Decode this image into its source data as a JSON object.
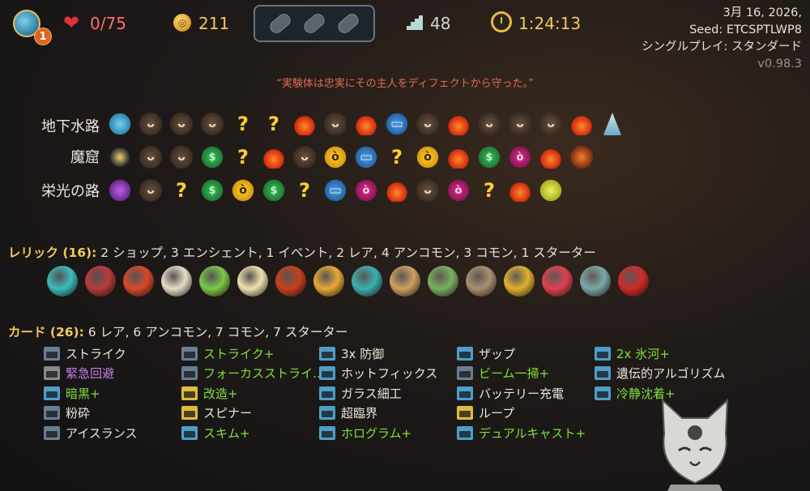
{
  "topbar": {
    "ascension": "1",
    "hp": "0/75",
    "gold": "211",
    "floor": "48",
    "time": "1:24:13",
    "potions": [
      "empty-slot",
      "empty-slot",
      "empty-slot"
    ]
  },
  "run_info": {
    "date": "3月 16, 2026,",
    "seed": "Seed: ETCSPTLWP8",
    "mode": "シングルプレイ: スタンダード",
    "version": "v0.98.3"
  },
  "quote": "“実験体は忠実にその主人をディフェクトから守った。”",
  "map": {
    "acts": [
      {
        "name": "地下水路",
        "nodes": [
          "boss-blue",
          "monster",
          "monster",
          "monster",
          "unknown",
          "unknown",
          "rest",
          "monster",
          "rest",
          "treasure",
          "monster",
          "rest",
          "monster",
          "monster",
          "monster",
          "rest",
          "final-crystal"
        ]
      },
      {
        "name": "魔窟",
        "nodes": [
          "boss-dark",
          "monster",
          "monster",
          "shop",
          "unknown",
          "rest",
          "monster",
          "elite",
          "treasure",
          "unknown",
          "elite",
          "rest",
          "shop",
          "elite2",
          "rest",
          "final-orange"
        ]
      },
      {
        "name": "栄光の路",
        "nodes": [
          "boss-purple",
          "monster",
          "unknown",
          "shop",
          "elite",
          "shop",
          "unknown",
          "treasure",
          "elite2",
          "rest",
          "monster",
          "elite2",
          "unknown",
          "rest",
          "final-yellow"
        ]
      }
    ],
    "node_glyphs": {
      "monster": "ᴗ",
      "unknown": "?",
      "rest": "",
      "treasure": "▭",
      "shop": "$",
      "elite": "ò",
      "elite2": "ò",
      "boss-blue": "",
      "boss-dark": "",
      "boss-purple": "",
      "final-crystal": "",
      "final-orange": "",
      "final-yellow": ""
    }
  },
  "relics": {
    "heading_label": "レリック (16):",
    "heading_detail": " 2 ショップ,  3 エンシェント,  1 イベント,  2 レア,  4 アンコモン,  3 コモン,  1 スターター",
    "items": [
      {
        "name": "cracked-core-icon",
        "color": "#3cbcbc"
      },
      {
        "name": "scissors-icon",
        "color": "#b83a3a"
      },
      {
        "name": "firework-icon",
        "color": "#d84a2a"
      },
      {
        "name": "cocoa-cup-icon",
        "color": "#e8dcc8"
      },
      {
        "name": "membership-card-icon",
        "color": "#7cc84a"
      },
      {
        "name": "lucky-cat-icon",
        "color": "#f0e0b0"
      },
      {
        "name": "brazier-icon",
        "color": "#c8401c"
      },
      {
        "name": "orrery-icon",
        "color": "#e8a838"
      },
      {
        "name": "bowl-icon",
        "color": "#3ab0b0"
      },
      {
        "name": "pyramid-icon",
        "color": "#d0a060"
      },
      {
        "name": "candelabra-icon",
        "color": "#7ab060"
      },
      {
        "name": "sack-icon",
        "color": "#a89070"
      },
      {
        "name": "vajra-icon",
        "color": "#e0b030"
      },
      {
        "name": "red-creature-icon",
        "color": "#e04050"
      },
      {
        "name": "spinning-top-icon",
        "color": "#7aa8a8"
      },
      {
        "name": "blood-vial-icon",
        "color": "#d02a2a"
      }
    ]
  },
  "cards": {
    "heading_label": "カード (26):",
    "heading_detail": " 6 レア,  6 アンコモン,  7 コモン,  7 スターター",
    "items": [
      {
        "label": "ストライク",
        "type": "attack",
        "upgraded": false
      },
      {
        "label": "緊急回避",
        "type": "status",
        "upgraded": false,
        "curse": true
      },
      {
        "label": "暗黒+",
        "type": "skill",
        "upgraded": true
      },
      {
        "label": "粉砕",
        "type": "attack",
        "upgraded": false
      },
      {
        "label": "アイスランス",
        "type": "attack",
        "upgraded": false
      },
      {
        "label": "ストライク+",
        "type": "attack",
        "upgraded": true
      },
      {
        "label": "フォーカスストライ…",
        "type": "attack",
        "upgraded": true
      },
      {
        "label": "改造+",
        "type": "power",
        "upgraded": true
      },
      {
        "label": "スピナー",
        "type": "power",
        "upgraded": false
      },
      {
        "label": "スキム+",
        "type": "skill",
        "upgraded": true
      },
      {
        "label": "3x 防御",
        "type": "skill",
        "upgraded": false
      },
      {
        "label": "ホットフィックス",
        "type": "skill",
        "upgraded": false
      },
      {
        "label": "ガラス細工",
        "type": "skill",
        "upgraded": false
      },
      {
        "label": "超臨界",
        "type": "skill",
        "upgraded": false
      },
      {
        "label": "ホログラム+",
        "type": "skill",
        "upgraded": true
      },
      {
        "label": "ザップ",
        "type": "skill",
        "upgraded": false
      },
      {
        "label": "ビーム一掃+",
        "type": "attack",
        "upgraded": true
      },
      {
        "label": "バッテリー充電",
        "type": "skill",
        "upgraded": false
      },
      {
        "label": "ループ",
        "type": "power",
        "upgraded": false
      },
      {
        "label": "デュアルキャスト+",
        "type": "skill",
        "upgraded": true
      },
      {
        "label": "2x 氷河+",
        "type": "skill",
        "upgraded": true
      },
      {
        "label": "遺伝的アルゴリズム",
        "type": "skill",
        "upgraded": false
      },
      {
        "label": "冷静沈着+",
        "type": "skill",
        "upgraded": true
      }
    ]
  }
}
